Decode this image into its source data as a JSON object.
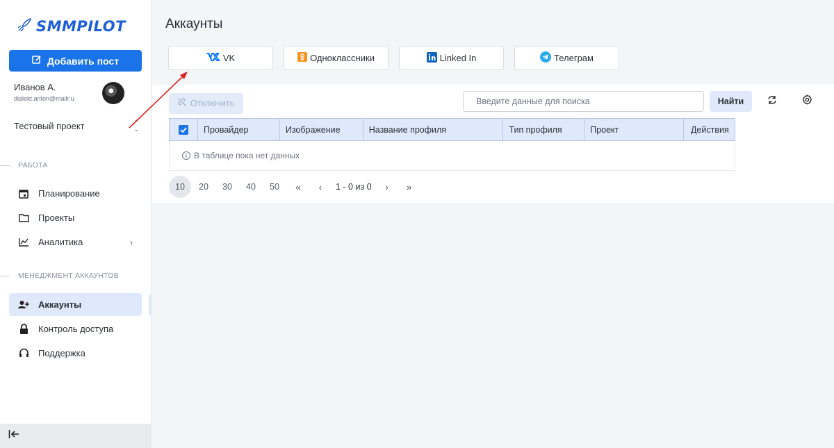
{
  "brand": {
    "logo_text": "SMMPILOT",
    "color": "#1f5fd6"
  },
  "sidebar": {
    "add_post_label": "Добавить пост",
    "user": {
      "name": "Иванов А.",
      "email": "dialekt.anton@mailr.u"
    },
    "project": "Тестовый проект",
    "sections": {
      "work": "РАБОТА",
      "accounts_mgmt": "МЕНЕДЖМЕНТ АККАУНТОВ"
    },
    "items": [
      {
        "label": "Планирование",
        "icon": "calendar-icon"
      },
      {
        "label": "Проекты",
        "icon": "folder-icon"
      },
      {
        "label": "Аналитика",
        "icon": "chart-icon"
      },
      {
        "label": "Аккаунты",
        "icon": "add-user-icon",
        "active": true
      },
      {
        "label": "Контроль доступа",
        "icon": "lock-icon"
      },
      {
        "label": "Поддержка",
        "icon": "headset-icon"
      }
    ]
  },
  "main": {
    "title": "Аккаунты",
    "providers": [
      {
        "label": "VK",
        "icon": "vk-icon",
        "color": "#0077ff"
      },
      {
        "label": "Одноклассники",
        "icon": "ok-icon",
        "color": "#f7931e"
      },
      {
        "label": "Linked In",
        "icon": "linkedin-icon",
        "color": "#0a66c2"
      },
      {
        "label": "Телеграм",
        "icon": "telegram-icon",
        "color": "#2aabee"
      }
    ],
    "disconnect_label": "Отключить",
    "search_placeholder": "Введите данные для поиска",
    "find_label": "Найти",
    "table": {
      "columns": [
        "Провайдер",
        "Изображение",
        "Название профиля",
        "Тип профиля",
        "Проект",
        "Действия"
      ],
      "empty_text": "В таблице пока нет данных"
    },
    "pagination": {
      "sizes": [
        "10",
        "20",
        "30",
        "40",
        "50"
      ],
      "active_size": "10",
      "range_text": "1 - 0 из 0"
    }
  },
  "colors": {
    "accent": "#1a73e8",
    "active_bg": "#dfe9fb",
    "annotation": "#e02020"
  }
}
